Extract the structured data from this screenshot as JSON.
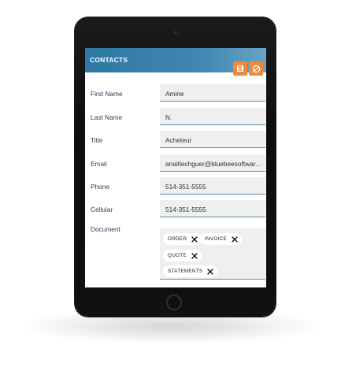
{
  "header": {
    "title": "CONTACTS"
  },
  "actions": {
    "save_icon": "save-icon",
    "cancel_icon": "cancel-icon",
    "accent": "#f08a3b"
  },
  "form": {
    "first_name": {
      "label": "First Name",
      "value": "Amine"
    },
    "last_name": {
      "label": "Last Name",
      "value": "N."
    },
    "title": {
      "label": "Title",
      "value": "Acheteur"
    },
    "email": {
      "label": "Email",
      "value": "anaitlechguer@bluebeesoftware...."
    },
    "phone": {
      "label": "Phone",
      "value": "514-351-5555"
    },
    "cellular": {
      "label": "Cellular",
      "value": "514-351-5555"
    },
    "document": {
      "label": "Document",
      "chips": [
        {
          "label": "ORDER"
        },
        {
          "label": "INVOICE"
        },
        {
          "label": "QUOTE"
        },
        {
          "label": "STATEMENTS"
        }
      ]
    }
  },
  "colors": {
    "header": "#2d78a4",
    "label": "#2d4057",
    "field_bg": "#efefef",
    "field_border": "#5d8fb0",
    "device": "#111111"
  }
}
